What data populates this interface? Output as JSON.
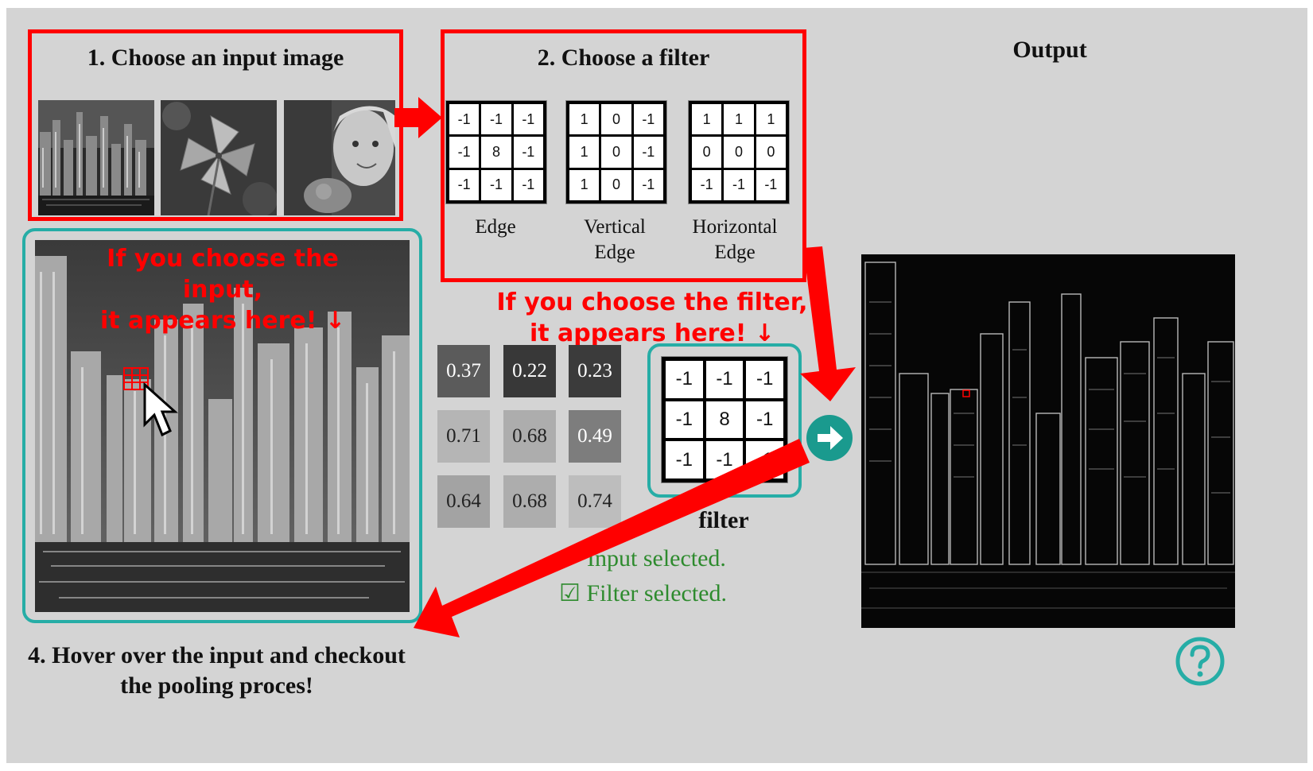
{
  "steps": {
    "choose_input": "1. Choose an input image",
    "choose_filter": "2. Choose a filter",
    "output": "Output",
    "hover": "4. Hover over the input and checkout\nthe pooling proces!"
  },
  "input_images": [
    {
      "icon": "city-skyline-thumbnail"
    },
    {
      "icon": "pinwheel-thumbnail"
    },
    {
      "icon": "child-portrait-thumbnail"
    }
  ],
  "filters": [
    {
      "label": "Edge",
      "values": [
        "-1",
        "-1",
        "-1",
        "-1",
        "8",
        "-1",
        "-1",
        "-1",
        "-1"
      ]
    },
    {
      "label": "Vertical\nEdge",
      "values": [
        "1",
        "0",
        "-1",
        "1",
        "0",
        "-1",
        "1",
        "0",
        "-1"
      ]
    },
    {
      "label": "Horizontal\nEdge",
      "values": [
        "1",
        "1",
        "1",
        "0",
        "0",
        "0",
        "-1",
        "-1",
        "-1"
      ]
    }
  ],
  "hints": {
    "input_hint": "If you choose the input,\nit appears here! ↓",
    "filter_hint": "If you choose the filter,\nit appears here! ↓"
  },
  "patch": {
    "values": [
      "0.37",
      "0.22",
      "0.23",
      "0.71",
      "0.68",
      "0.49",
      "0.64",
      "0.68",
      "0.74"
    ]
  },
  "selected_filter": {
    "label": "filter",
    "values": [
      "-1",
      "-1",
      "-1",
      "-1",
      "8",
      "-1",
      "-1",
      "-1",
      "-1"
    ]
  },
  "status": {
    "input": "Input selected.",
    "filter": "☑ Filter selected."
  },
  "colors": {
    "annotation": "#ff0000",
    "accent": "#26ada6",
    "status": "#2e8b2e",
    "background": "#d4d4d4"
  }
}
